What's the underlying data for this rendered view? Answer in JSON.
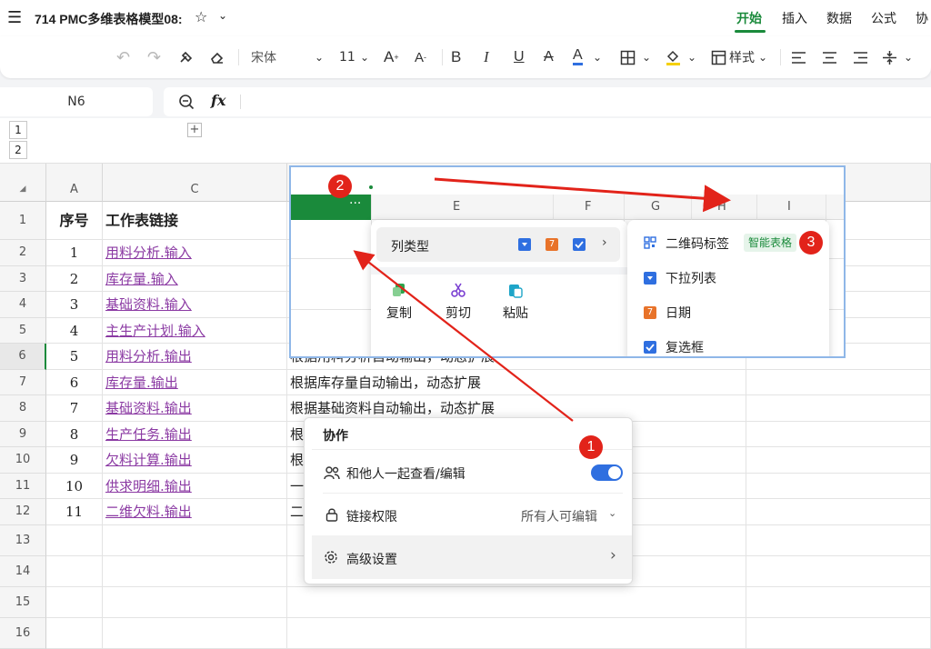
{
  "titlebar": {
    "doc_title": "714 PMC多维表格模型08:",
    "tabs": [
      "开始",
      "插入",
      "数据",
      "公式",
      "协"
    ]
  },
  "toolbar": {
    "font_name": "宋体",
    "font_size": "11",
    "style_label": "样式"
  },
  "formula_bar": {
    "cell_ref": "N6",
    "fx_label": "fx"
  },
  "outline_levels": [
    "1",
    "2"
  ],
  "grid": {
    "col_labels": [
      "A",
      "C"
    ],
    "header": {
      "num": "序号",
      "link": "工作表链接"
    },
    "rows": [
      {
        "row": "1",
        "num": "",
        "link": "",
        "desc": ""
      },
      {
        "row": "2",
        "num": "1",
        "link": "用料分析.输入",
        "desc": ""
      },
      {
        "row": "3",
        "num": "2",
        "link": "库存量.输入",
        "desc": ""
      },
      {
        "row": "4",
        "num": "3",
        "link": "基础资料.输入",
        "desc": ""
      },
      {
        "row": "5",
        "num": "4",
        "link": "主生产计划.输入",
        "desc": ""
      },
      {
        "row": "6",
        "num": "5",
        "link": "用料分析.输出",
        "desc": "根据用料分析自动输出，动态扩展"
      },
      {
        "row": "7",
        "num": "6",
        "link": "库存量.输出",
        "desc": "根据库存量自动输出，动态扩展"
      },
      {
        "row": "8",
        "num": "7",
        "link": "基础资料.输出",
        "desc": "根据基础资料自动输出，动态扩展"
      },
      {
        "row": "9",
        "num": "8",
        "link": "生产任务.输出",
        "desc": "根"
      },
      {
        "row": "10",
        "num": "9",
        "link": "欠料计算.输出",
        "desc": "根"
      },
      {
        "row": "11",
        "num": "10",
        "link": "供求明细.输出",
        "desc": "一"
      },
      {
        "row": "12",
        "num": "11",
        "link": "二维欠料.输出",
        "desc": "二"
      },
      {
        "row": "13",
        "num": "",
        "link": "",
        "desc": ""
      },
      {
        "row": "14",
        "num": "",
        "link": "",
        "desc": ""
      },
      {
        "row": "15",
        "num": "",
        "link": "",
        "desc": ""
      },
      {
        "row": "16",
        "num": "",
        "link": "",
        "desc": ""
      }
    ]
  },
  "inset": {
    "col_labels": [
      "E",
      "F",
      "G",
      "H",
      "I"
    ],
    "dots": "···",
    "menu_coltype": "列类型",
    "menu_actions": [
      "复制",
      "剪切",
      "粘贴"
    ],
    "submenu": {
      "items": [
        "二维码标签",
        "下拉列表",
        "日期",
        "复选框"
      ],
      "smart_badge": "智能表格"
    }
  },
  "collab": {
    "title": "协作",
    "view_edit_label": "和他人一起查看/编辑",
    "view_edit_enabled": true,
    "link_perm_label": "链接权限",
    "link_perm_value": "所有人可编辑",
    "advanced_label": "高级设置"
  },
  "annotations": {
    "badges": [
      "1",
      "2",
      "3"
    ]
  },
  "colors": {
    "accent_green": "#1a8a3b",
    "link_purple": "#8b3aa3",
    "annotation_red": "#e2231a",
    "toggle_blue": "#2f6fe0"
  }
}
